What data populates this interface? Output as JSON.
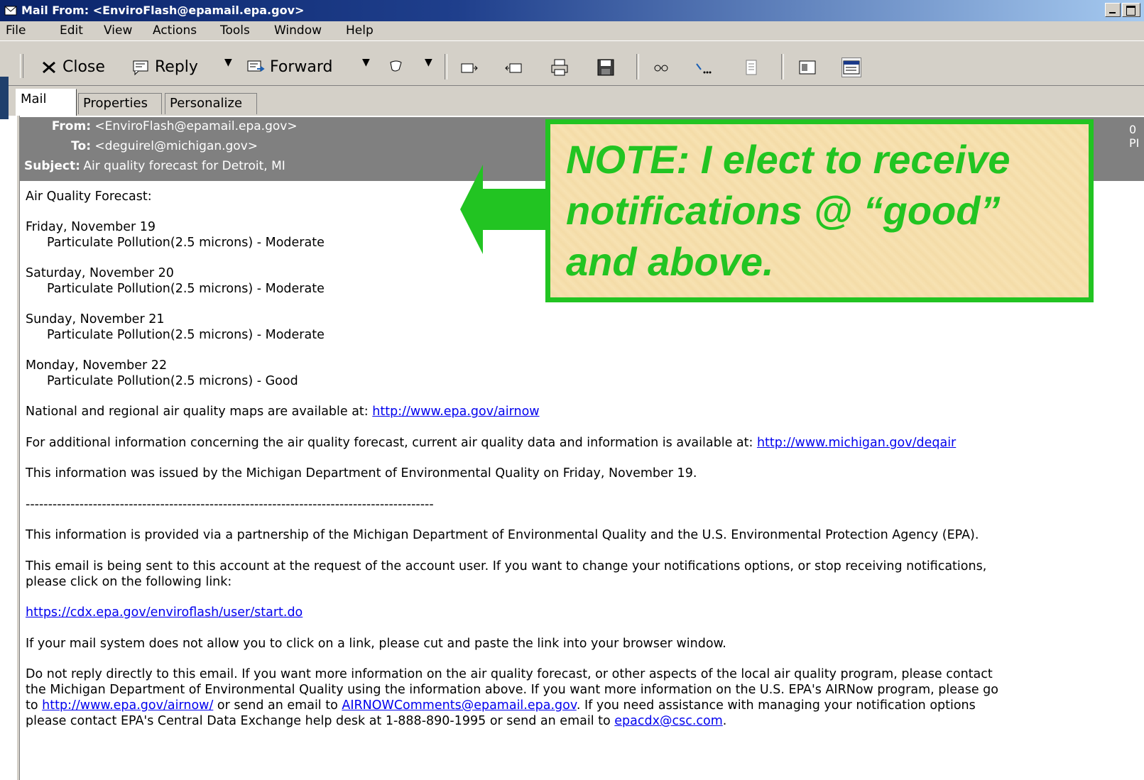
{
  "window": {
    "title": "Mail From: <EnviroFlash@epamail.epa.gov>"
  },
  "menu": [
    "File",
    "Edit",
    "View",
    "Actions",
    "Tools",
    "Window",
    "Help"
  ],
  "toolbar": {
    "close_label": "Close",
    "reply_label": "Reply",
    "forward_label": "Forward"
  },
  "tabs": [
    "Mail",
    "Properties",
    "Personalize"
  ],
  "header": {
    "from_label": "From:",
    "from_value": "<EnviroFlash@epamail.epa.gov>",
    "to_label": "To:",
    "to_value": "<deguirel@michigan.gov>",
    "subject_label": "Subject:",
    "subject_value": "Air quality forecast for Detroit, MI",
    "date_fragment": "0 PI"
  },
  "body": {
    "intro": "Air Quality Forecast:",
    "forecast": [
      {
        "day": "Friday, November 19",
        "detail": "Particulate Pollution(2.5 microns) - Moderate"
      },
      {
        "day": "Saturday, November 20",
        "detail": "Particulate Pollution(2.5 microns) - Moderate"
      },
      {
        "day": "Sunday, November 21",
        "detail": "Particulate Pollution(2.5 microns) - Moderate"
      },
      {
        "day": "Monday, November 22",
        "detail": "Particulate Pollution(2.5 microns) - Good"
      }
    ],
    "maps_text": "National and regional air quality maps are available at: ",
    "maps_link": "http://www.epa.gov/airnow",
    "additional_text": "For additional information concerning the air quality forecast, current air quality data and information is available at: ",
    "additional_link": "http://www.michigan.gov/deqair",
    "issued": "This information was issued by the Michigan Department of Environmental Quality on Friday, November 19.",
    "divider": "-------------------------------------------------------------------------------------------",
    "partnership": "This information is provided via a partnership of the Michigan Department of Environmental Quality and the U.S. Environmental Protection Agency (EPA).",
    "sent_line1": "This email is being sent to this account at the request of the account user.  If you want to change your notifications options, or stop receiving notifications,",
    "sent_line2": "please click on the following link:",
    "start_link": "https://cdx.epa.gov/enviroflash/user/start.do",
    "paste_text": "If your mail system does not allow you to click on a link, please cut and paste the link into your browser window.",
    "noreply_line1": "Do not reply directly to this email. If you want more information on the air quality forecast, or other aspects of the local air quality program, please contact",
    "noreply_line2": "the Michigan Department of Environmental Quality using the information above. If you want more information on the U.S. EPA's AIRNow program, please go",
    "noreply_line3_pre": "to ",
    "noreply_link1": "http://www.epa.gov/airnow/",
    "noreply_line3_mid": " or send an email to ",
    "noreply_link2": "AIRNOWComments@epamail.epa.gov",
    "noreply_line3_post": ". If you need assistance with managing your notification options",
    "noreply_line4_pre": "please contact EPA's Central Data Exchange help desk at 1-888-890-1995 or send an email to ",
    "noreply_link3": "epacdx@csc.com",
    "noreply_line4_post": "."
  },
  "note": {
    "line1": "NOTE:  I elect to receive",
    "line2": "notifications @ “good”",
    "line3": "and above.",
    "color": "#22c422"
  }
}
